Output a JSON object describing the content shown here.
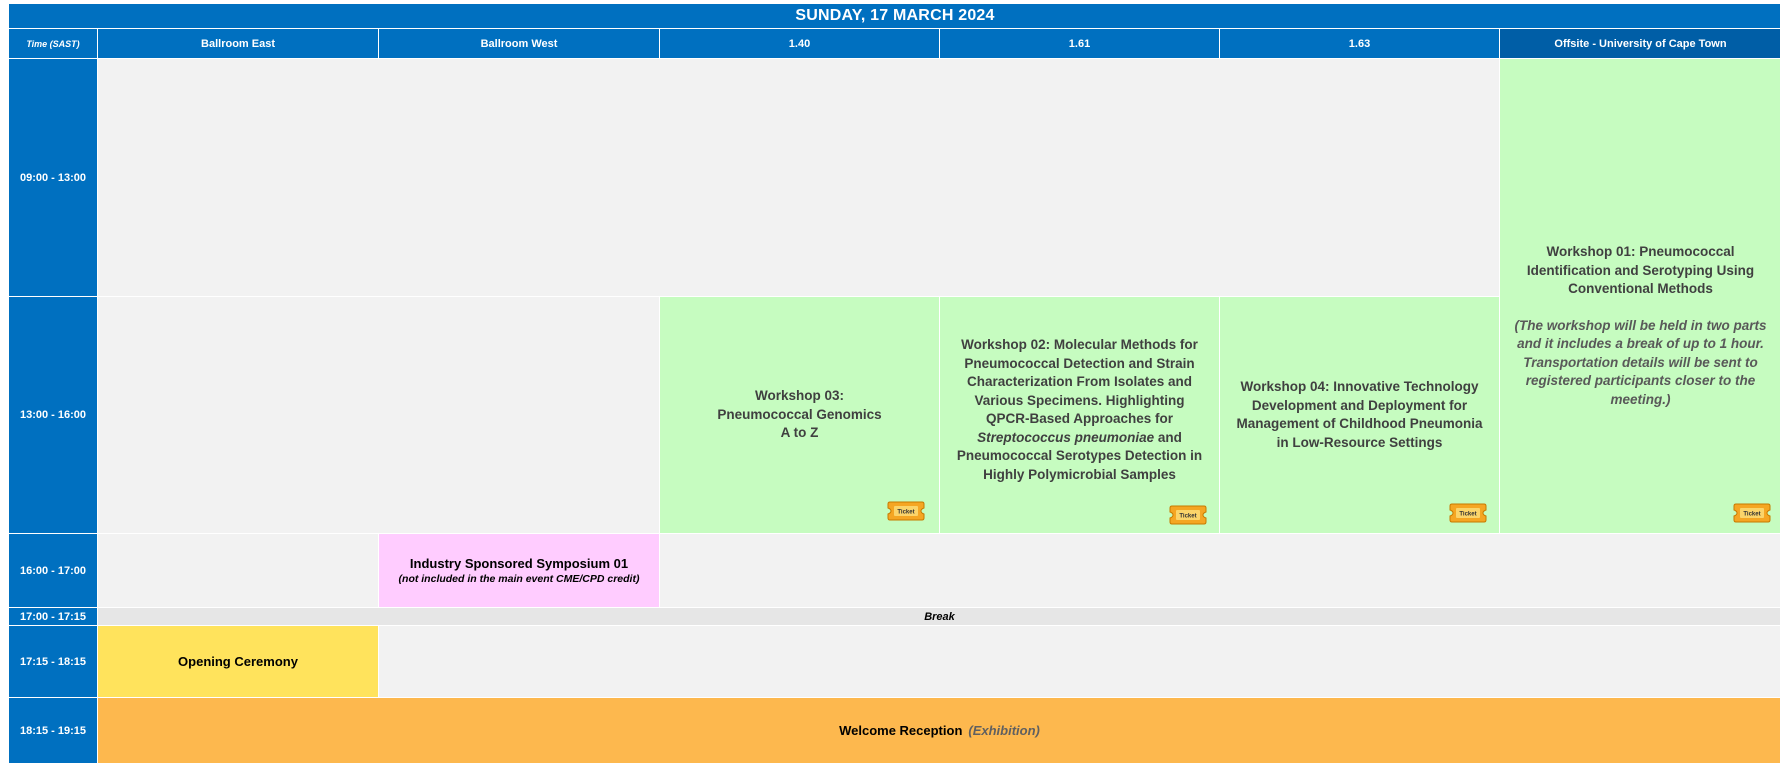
{
  "schedule": {
    "date_title": "SUNDAY, 17 MARCH 2024",
    "time_header_prefix": "Time",
    "time_header_zone": "(SAST)",
    "rooms": [
      "Ballroom East",
      "Ballroom West",
      "1.40",
      "1.61",
      "1.63",
      "Offsite - University of Cape Town"
    ],
    "times": [
      "09:00 - 13:00",
      "13:00 - 16:00",
      "16:00 - 17:00",
      "17:00 - 17:15",
      "17:15 - 18:15",
      "18:15 - 19:15"
    ],
    "sessions": {
      "workshop01": {
        "title": "Workshop 01: Pneumococcal Identification and Serotyping Using Conventional Methods",
        "note": "(The workshop will be held in two parts and it includes a break of up to 1 hour. Transportation details will be sent to registered participants closer to the meeting.)"
      },
      "workshop03": {
        "line1": "Workshop 03:",
        "line2": "Pneumococcal Genomics",
        "line3": "A to Z"
      },
      "workshop02": {
        "part1": "Workshop 02: Molecular Methods for Pneumococcal Detection and Strain Characterization From Isolates and Various Specimens. Highlighting QPCR-Based Approaches for ",
        "species": "Streptococcus pneumoniae",
        "part2": " and Pneumococcal Serotypes Detection in Highly Polymicrobial Samples"
      },
      "workshop04": {
        "title": "Workshop 04: Innovative Technology Development and Deployment for Management of Childhood Pneumonia in Low-Resource Settings"
      },
      "symposium01": {
        "title": "Industry Sponsored Symposium 01",
        "note": "(not included in the main event CME/CPD credit)"
      },
      "break_label": "Break",
      "opening": "Opening Ceremony",
      "reception": "Welcome Reception",
      "reception_note": "(Exhibition)"
    },
    "ticket_label": "Ticket"
  },
  "colors": {
    "header_blue": "#0070c0",
    "workshop_green": "#c6fcc0",
    "symposium_pink": "#ffccff",
    "opening_yellow": "#ffe35c",
    "reception_orange": "#fdb84e",
    "empty_grey": "#f2f2f2",
    "ticket_orange": "#f5a623"
  }
}
